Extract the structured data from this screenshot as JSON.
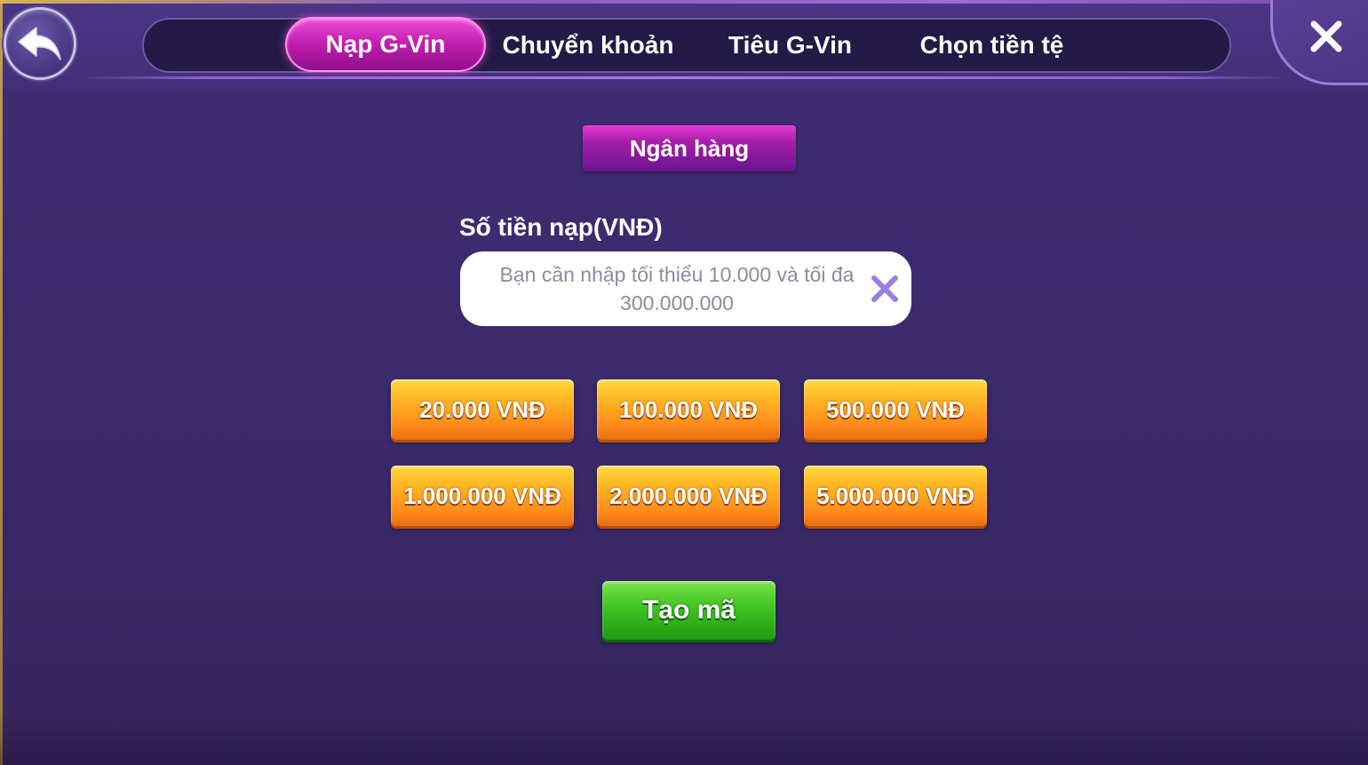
{
  "tabs": [
    {
      "label": "Nạp G-Vin",
      "active": true
    },
    {
      "label": "Chuyển khoản",
      "active": false
    },
    {
      "label": "Tiêu G-Vin",
      "active": false
    },
    {
      "label": "Chọn tiền tệ",
      "active": false
    }
  ],
  "method": {
    "label": "Ngân hàng"
  },
  "amount": {
    "label": "Số tiền nạp(VNĐ)",
    "value": "",
    "placeholder_line1": "Bạn cần nhập tối thiểu 10.000 và tối đa",
    "placeholder_line2": "300.000.000"
  },
  "presets": [
    {
      "label": "20.000 VNĐ"
    },
    {
      "label": "100.000 VNĐ"
    },
    {
      "label": "500.000 VNĐ"
    },
    {
      "label": "1.000.000 VNĐ"
    },
    {
      "label": "2.000.000 VNĐ"
    },
    {
      "label": "5.000.000 VNĐ"
    }
  ],
  "submit": {
    "label": "Tạo mã"
  },
  "icons": {
    "back": "back-arrow-icon",
    "close": "close-icon",
    "clear": "clear-input-icon"
  },
  "colors": {
    "background": "#3b2a6c",
    "tab_active": "#c41fb2",
    "preset_button": "#ffb423",
    "submit_button": "#3fc321",
    "clear_icon": "#9b7fe0"
  }
}
